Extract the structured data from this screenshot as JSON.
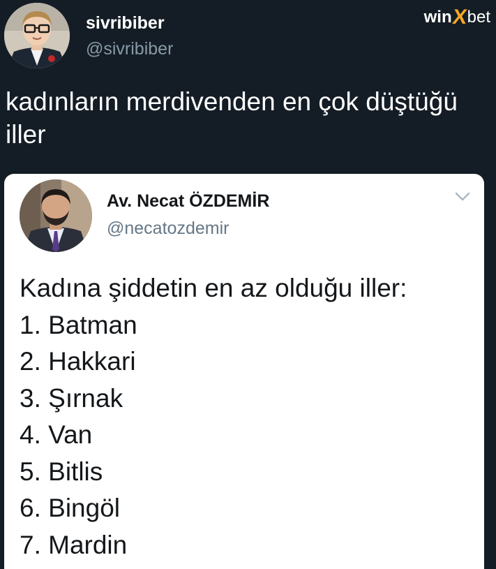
{
  "outer_tweet": {
    "display_name": "sivribiber",
    "handle": "@sivribiber",
    "text": "kadınların merdivenden en çok düştüğü iller",
    "avatar_icon": "profile-photo-man-glasses"
  },
  "brand": {
    "part1": "win",
    "part2": "X",
    "part3": "bet",
    "accent_color": "#f5a623"
  },
  "quoted_tweet": {
    "display_name": "Av. Necat ÖZDEMİR",
    "handle": "@necatozdemir",
    "avatar_icon": "profile-photo-man-suit",
    "menu_icon": "chevron-down-icon",
    "heading": "Kadına şiddetin en az olduğu iller:",
    "list": [
      "1. Batman",
      "2. Hakkari",
      "3. Şırnak",
      "4. Van",
      "5. Bitlis",
      "6. Bingöl",
      "7. Mardin"
    ]
  },
  "colors": {
    "background": "#141d26",
    "card": "#ffffff",
    "handle_dark": "#8899a6",
    "handle_light": "#657786"
  }
}
